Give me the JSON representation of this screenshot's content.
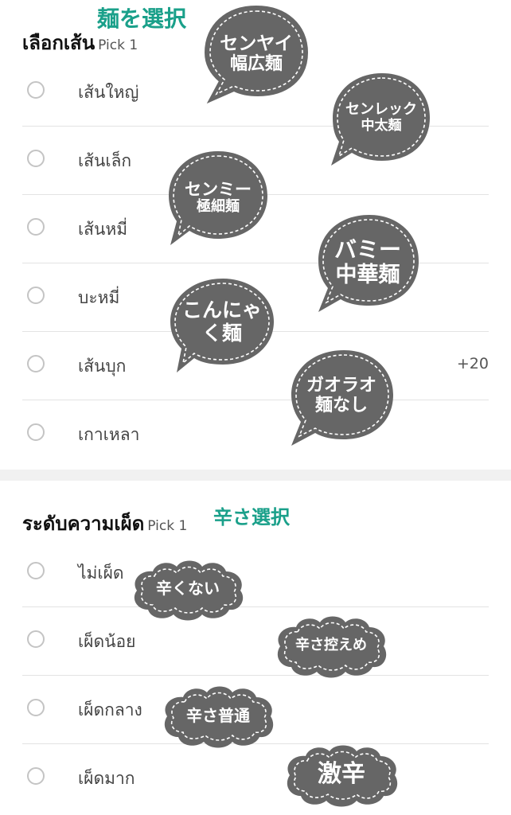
{
  "noodle_section": {
    "title": "เลือกเส้น",
    "pick": "Pick 1",
    "annotation": "麺を選択",
    "options": [
      {
        "label": "เส้นใหญ่",
        "price": ""
      },
      {
        "label": "เส้นเล็ก",
        "price": ""
      },
      {
        "label": "เส้นหมี่",
        "price": ""
      },
      {
        "label": "บะหมี่",
        "price": ""
      },
      {
        "label": "เส้นบุก",
        "price": "+20"
      },
      {
        "label": "เกาเหลา",
        "price": ""
      }
    ],
    "bubbles": [
      {
        "line1": "センヤイ",
        "line2": "幅広麺"
      },
      {
        "line1": "センレック",
        "line2": "中太麺"
      },
      {
        "line1": "センミー",
        "line2": "極細麺"
      },
      {
        "line1": "バミー",
        "line2": "中華麺"
      },
      {
        "line1": "こんにゃ",
        "line2": "く麺"
      },
      {
        "line1": "ガオラオ",
        "line2": "麺なし"
      }
    ]
  },
  "spice_section": {
    "title": "ระดับความเผ็ด",
    "pick": "Pick 1",
    "annotation": "辛さ選択",
    "options": [
      {
        "label": "ไม่เผ็ด"
      },
      {
        "label": "เผ็ดน้อย"
      },
      {
        "label": "เผ็ดกลาง"
      },
      {
        "label": "เผ็ดมาก"
      }
    ],
    "bubbles": [
      {
        "text": "辛くない"
      },
      {
        "text": "辛さ控えめ"
      },
      {
        "text": "辛さ普通"
      },
      {
        "text": "激辛"
      }
    ]
  },
  "colors": {
    "accent": "#1aa08a",
    "bubble": "#666666",
    "radio": "#c4c4c4"
  }
}
